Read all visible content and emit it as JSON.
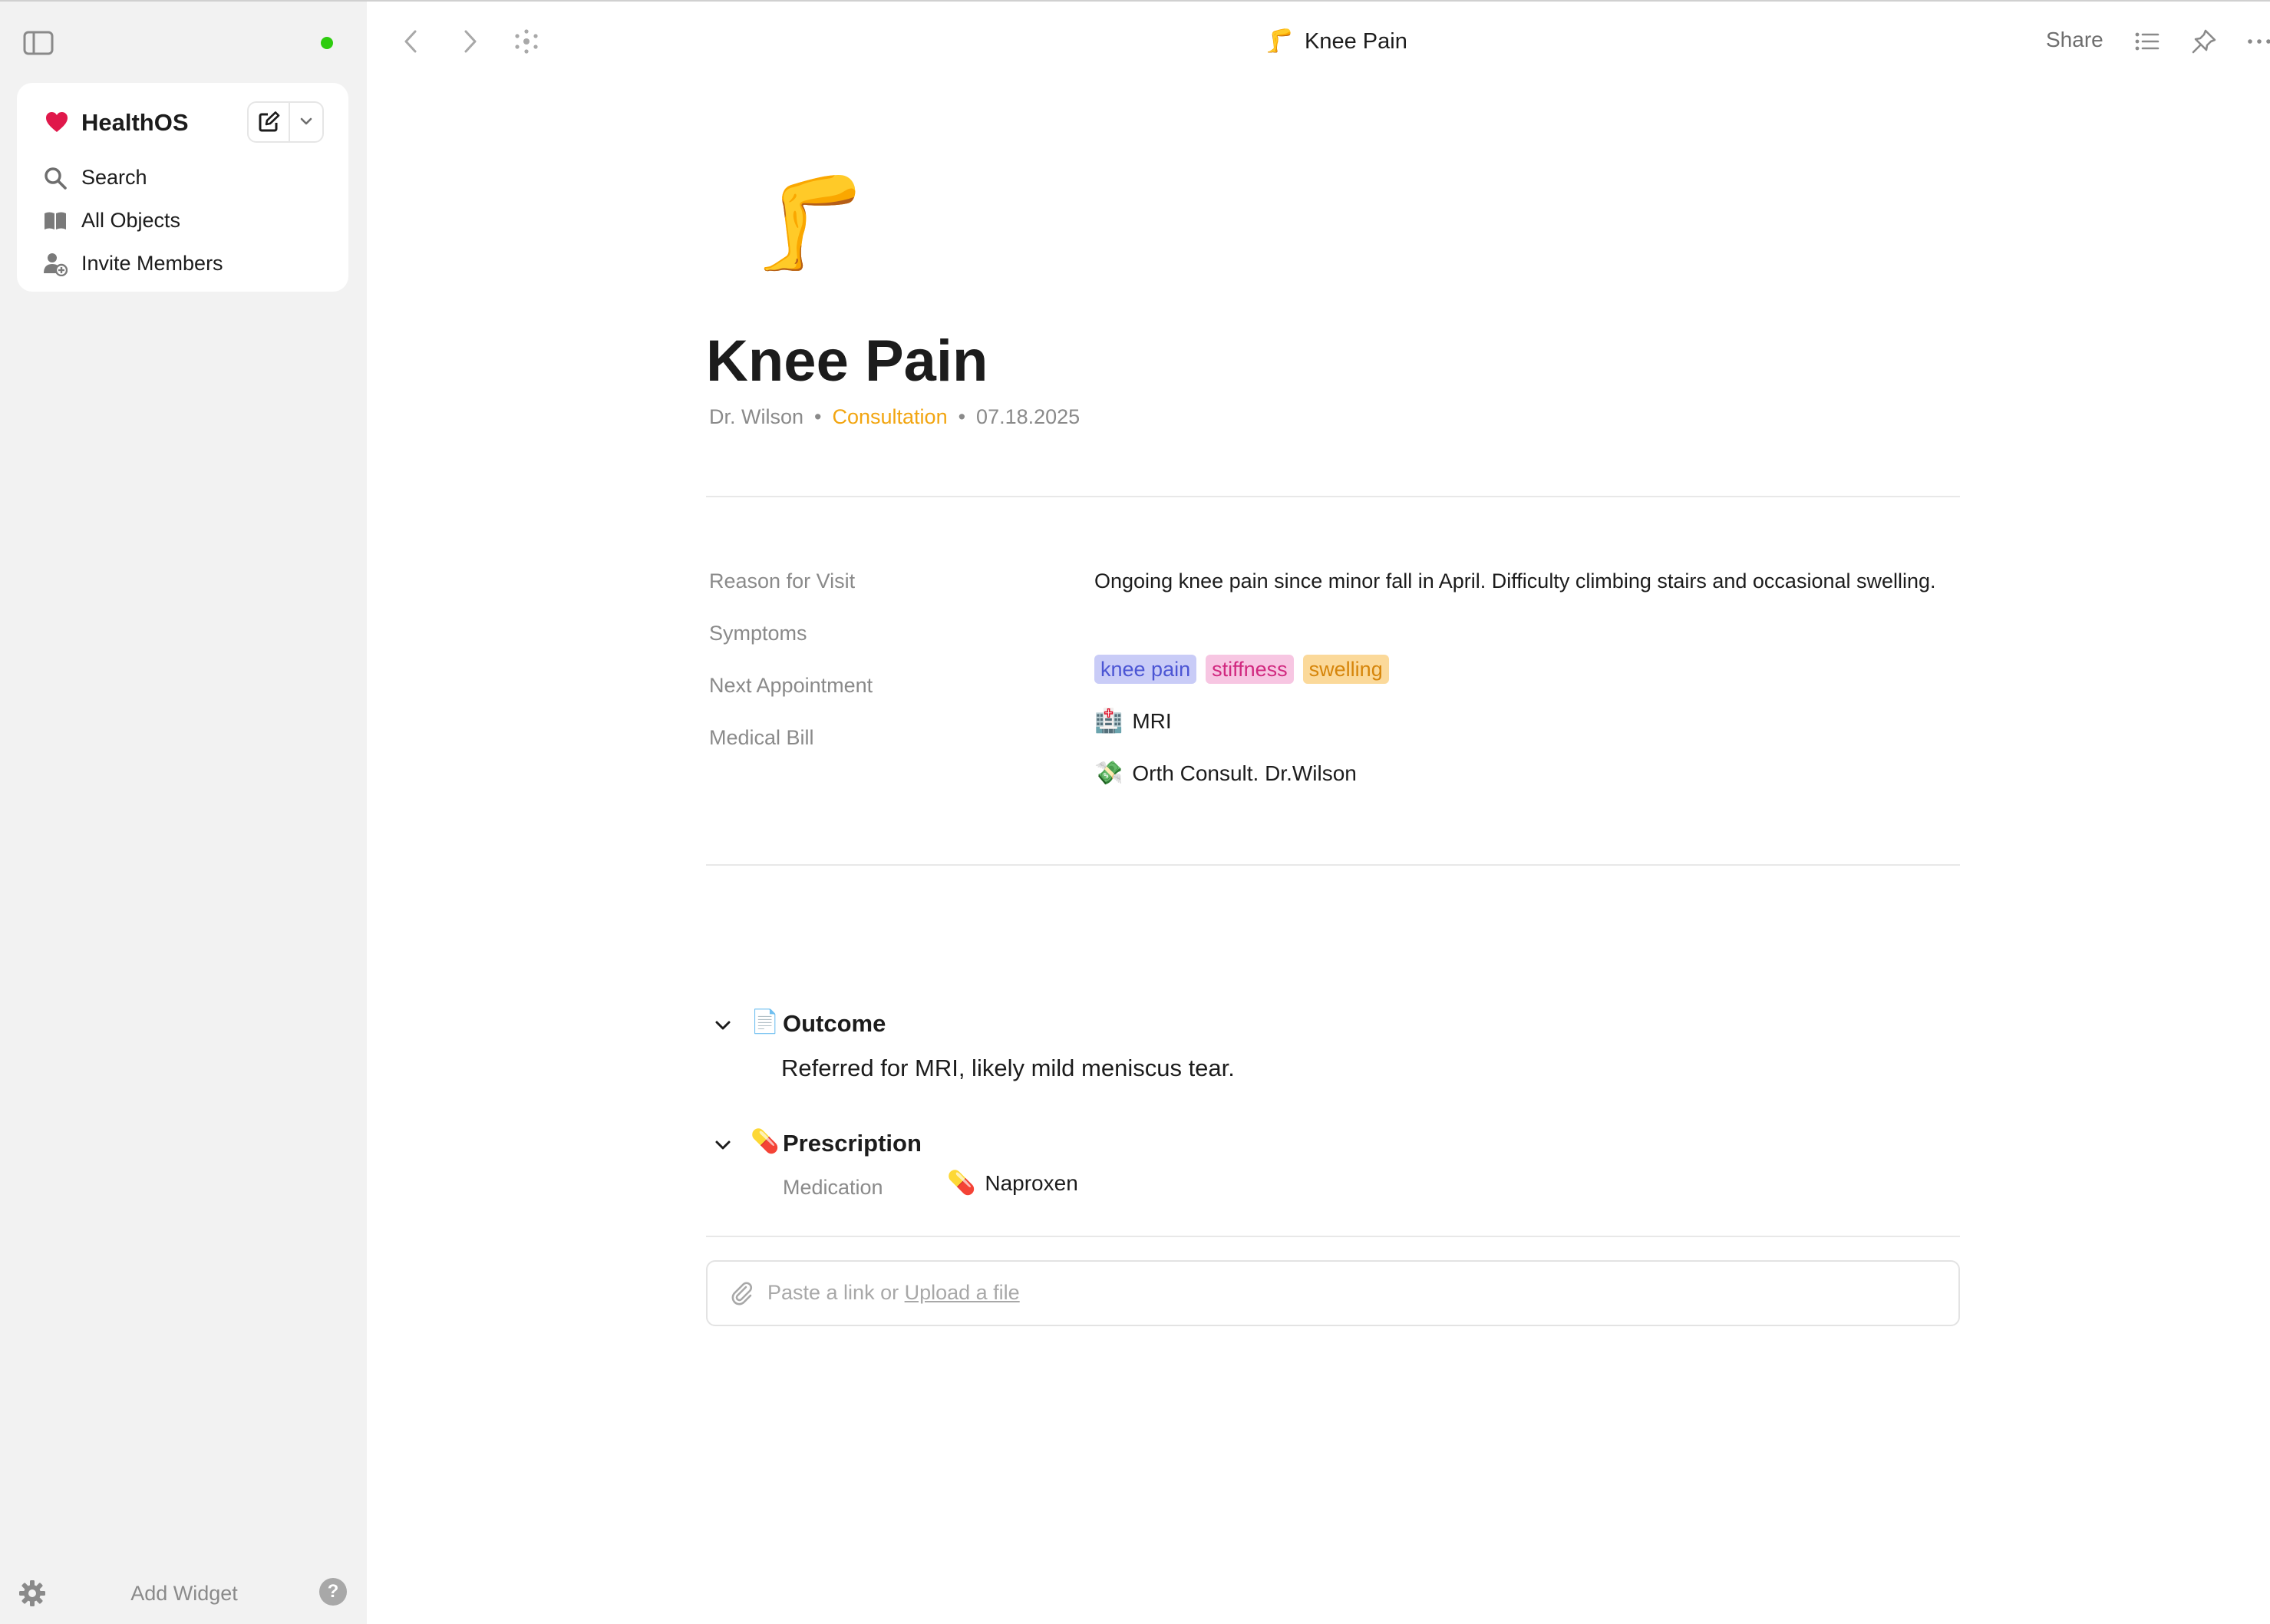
{
  "sidebar": {
    "space_name": "HealthOS",
    "nav": [
      {
        "label": "Search",
        "icon": "search-icon"
      },
      {
        "label": "All Objects",
        "icon": "book-icon"
      },
      {
        "label": "Invite Members",
        "icon": "add-person-icon"
      }
    ],
    "footer": {
      "add_widget": "Add Widget",
      "help": "?"
    },
    "status_color": "#2ecc0f",
    "accent_color": "#e0184b"
  },
  "topbar": {
    "crumb_emoji": "🦵",
    "crumb_title": "Knee Pain",
    "share_label": "Share"
  },
  "page": {
    "icon": "🦵",
    "title": "Knee Pain",
    "meta": {
      "author": "Dr. Wilson",
      "separator": "•",
      "type": "Consultation",
      "date": "07.18.2025"
    },
    "properties": {
      "reason": {
        "label": "Reason for Visit",
        "value": "Ongoing knee pain since minor fall in April. Difficulty climbing stairs and occasional swelling."
      },
      "symptoms": {
        "label": "Symptoms",
        "tags": [
          "knee pain",
          "stiffness",
          "swelling"
        ]
      },
      "next_appointment": {
        "label": "Next Appointment",
        "emoji": "🏥",
        "value": "MRI"
      },
      "medical_bill": {
        "label": "Medical Bill",
        "emoji": "💸",
        "value": "Orth Consult. Dr.Wilson"
      }
    },
    "sections": {
      "outcome": {
        "emoji": "📄",
        "title": "Outcome",
        "text": "Referred for MRI, likely mild meniscus tear."
      },
      "prescription": {
        "emoji": "💊",
        "title": "Prescription",
        "medication_label": "Medication",
        "medication_emoji": "💊",
        "medication_value": "Naproxen"
      }
    },
    "attach": {
      "prefix": "Paste a link or ",
      "link": "Upload a file"
    }
  }
}
